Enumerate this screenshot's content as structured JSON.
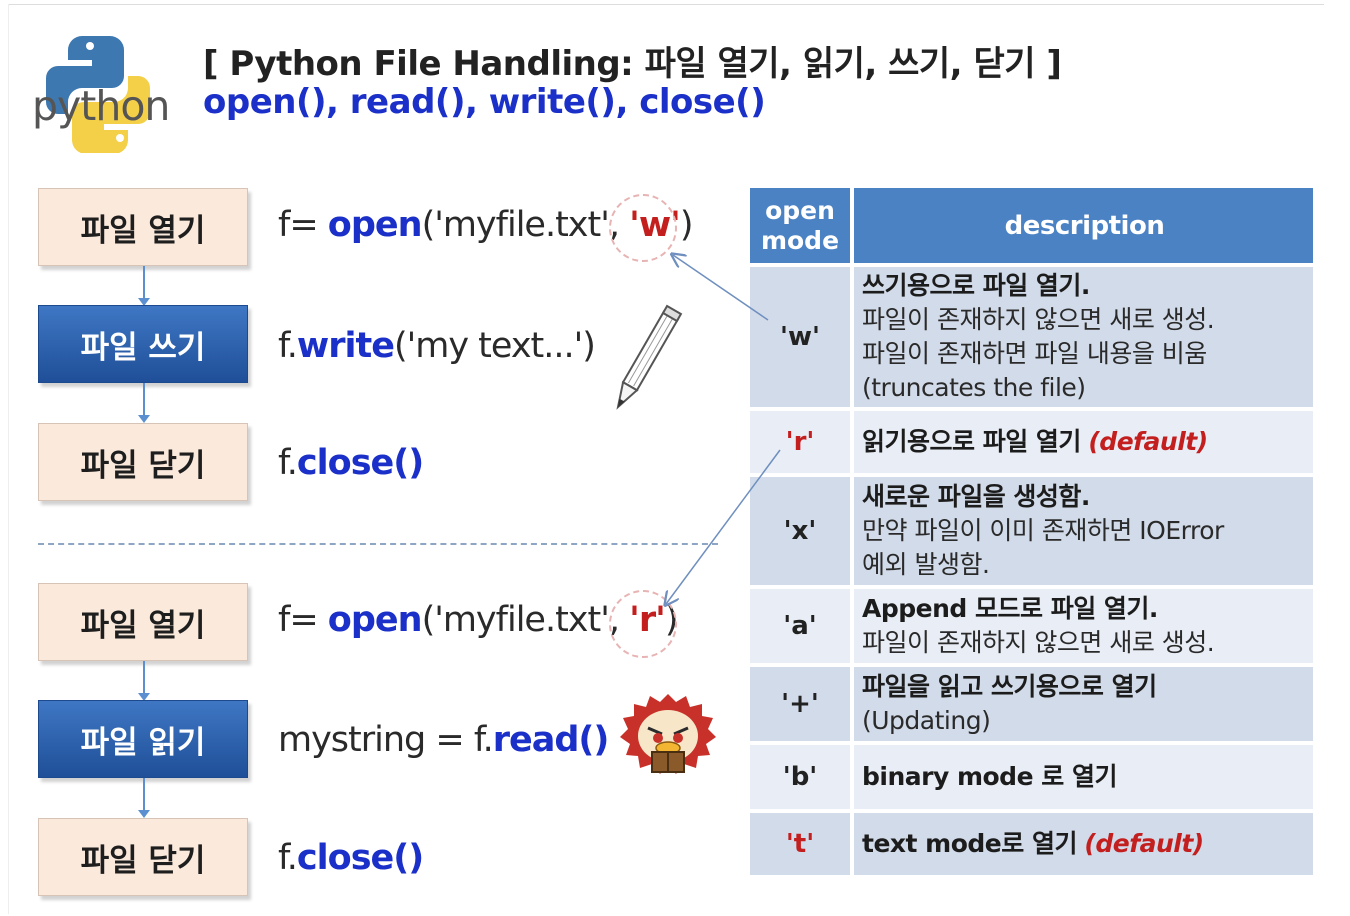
{
  "header": {
    "title": "[ Python File Handling: 파일 열기, 읽기, 쓰기, 닫기 ]",
    "subtitle": "open(), read(), write(), close()",
    "logo_text": "python"
  },
  "write_flow": {
    "steps": [
      "파일 열기",
      "파일 쓰기",
      "파일 닫기"
    ],
    "open_fn": "open",
    "open_args": "('myfile.txt',",
    "open_mode": "'w'",
    "write_obj": "f.",
    "write_fn": "write",
    "write_args": "('my text...')",
    "close_obj": "f.",
    "close_fn": "close()"
  },
  "read_flow": {
    "steps": [
      "파일 열기",
      "파일 읽기",
      "파일 닫기"
    ],
    "open_fn": "open",
    "open_args": "('myfile.txt',",
    "open_mode": "'r'",
    "read_prefix": "mystring = f.",
    "read_fn": "read()",
    "close_obj": "f.",
    "close_fn": "close()"
  },
  "code_prefix": "f=",
  "table": {
    "header_mode_line1": "open",
    "header_mode_line2": "mode",
    "header_desc": "description",
    "rows": [
      {
        "mode": "'w'",
        "line1": "쓰기용으로 파일 열기.",
        "line2": "파일이 존재하지 않으면 새로 생성.",
        "line3": "파일이 존재하면 파일 내용을 비움",
        "line4": "(truncates the file)"
      },
      {
        "mode": "'r'",
        "line1": "읽기용으로 파일 열기",
        "tag": "(default)"
      },
      {
        "mode": "'x'",
        "line1": "새로운 파일을 생성함.",
        "line2": "만약 파일이 이미 존재하면 IOError",
        "line3": "예외 발생함."
      },
      {
        "mode": "'a'",
        "line1": "Append 모드로 파일 열기.",
        "line2": "파일이 존재하지 않으면 새로 생성."
      },
      {
        "mode": "'+'",
        "line1": "파일을 읽고 쓰기용으로 열기",
        "line2": "(Updating)"
      },
      {
        "mode": "'b'",
        "line1": "binary mode 로 열기"
      },
      {
        "mode": "'t'",
        "line1": "text mode로 열기",
        "tag": "(default)"
      }
    ]
  },
  "colors": {
    "keyword_blue": "#1a30c8",
    "mode_red": "#c41f1f",
    "step_light": "#fbe9dc",
    "step_dark": "#2a62b0",
    "table_header": "#4a82c4",
    "row_dark": "#d2dbe9",
    "row_light": "#e9eef6"
  },
  "icons": [
    "python-logo",
    "pencil-icon",
    "mascot-with-box-icon"
  ]
}
